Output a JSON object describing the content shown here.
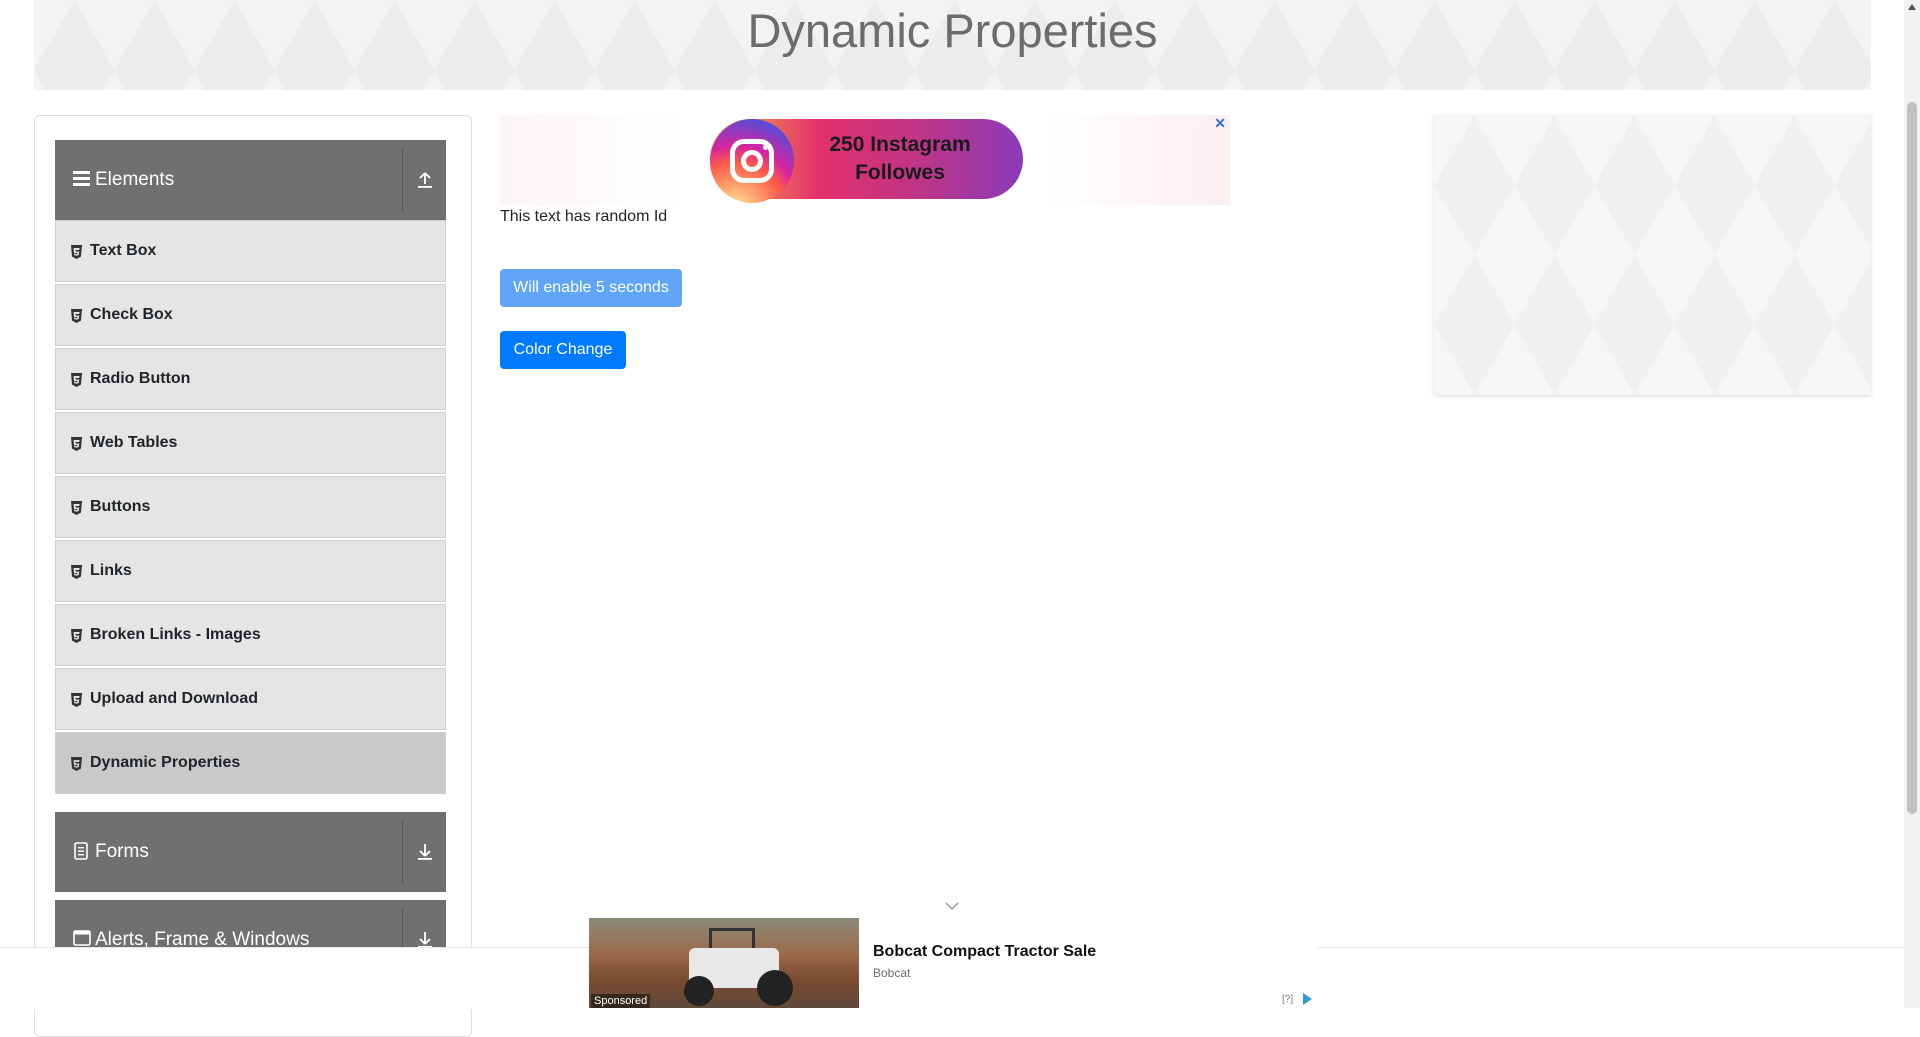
{
  "page": {
    "title": "Dynamic Properties"
  },
  "sidebar": {
    "groups": [
      {
        "label": "Elements",
        "icon": "hamburger-icon",
        "toggle_icon": "upload-icon"
      },
      {
        "label": "Forms",
        "icon": "document-icon",
        "toggle_icon": "download-icon"
      },
      {
        "label": "Alerts, Frame & Windows",
        "icon": "window-icon",
        "toggle_icon": "download-icon"
      }
    ],
    "items": [
      {
        "label": "Text Box"
      },
      {
        "label": "Check Box"
      },
      {
        "label": "Radio Button"
      },
      {
        "label": "Web Tables"
      },
      {
        "label": "Buttons"
      },
      {
        "label": "Links"
      },
      {
        "label": "Broken Links - Images"
      },
      {
        "label": "Upload and Download"
      },
      {
        "label": "Dynamic Properties",
        "active": true
      }
    ]
  },
  "ad_top": {
    "text": "250 Instagram\nFollowes",
    "close": "✕"
  },
  "main": {
    "random_text": "This text has random Id",
    "enable_button": "Will enable 5 seconds",
    "color_button": "Color Change"
  },
  "bottom_ad": {
    "title": "Bobcat Compact Tractor Sale",
    "brand": "Bobcat",
    "sponsored": "Sponsored",
    "info": "[?]"
  },
  "colors": {
    "sidebar_header": "#707070",
    "menu_item": "#e5e5e5",
    "menu_item_active": "#c9c9c9",
    "primary_button": "#007bff",
    "disabled_button": "#60a5f7"
  }
}
